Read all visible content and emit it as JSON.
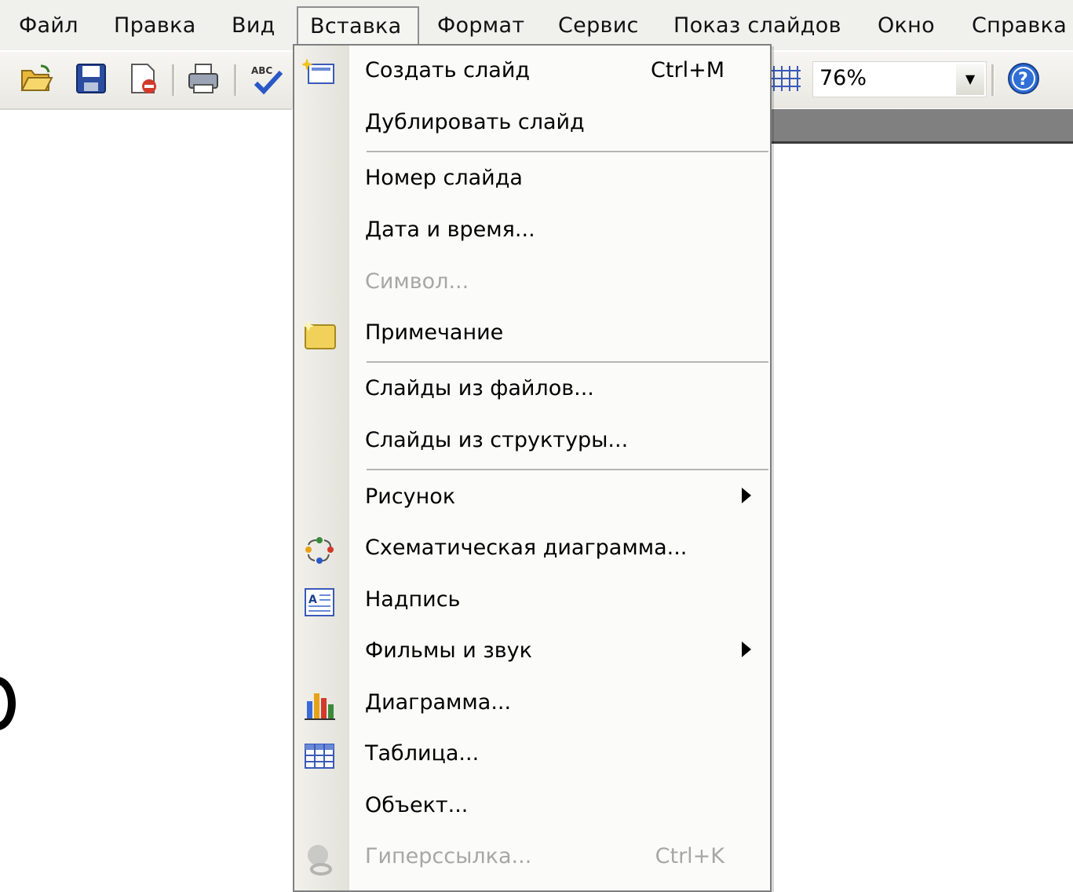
{
  "menubar": {
    "items": [
      {
        "label": "Файл",
        "open": false
      },
      {
        "label": "Правка",
        "open": false
      },
      {
        "label": "Вид",
        "open": false
      },
      {
        "label": "Вставка",
        "open": true
      },
      {
        "label": "Формат",
        "open": false
      },
      {
        "label": "Сервис",
        "open": false
      },
      {
        "label": "Показ слайдов",
        "open": false
      },
      {
        "label": "Окно",
        "open": false
      },
      {
        "label": "Справка",
        "open": false
      }
    ]
  },
  "toolbar": {
    "icons": [
      "open-folder-icon",
      "save-icon",
      "permission-icon",
      "print-icon",
      "spelling-icon",
      "grid-icon",
      "help-icon"
    ],
    "zoom": {
      "value": "76%"
    }
  },
  "dropdown": {
    "items": [
      {
        "label": "Создать слайд",
        "shortcut": "Ctrl+M",
        "icon": "new-slide-icon",
        "enabled": true
      },
      {
        "label": "Дублировать слайд",
        "shortcut": "",
        "icon": "",
        "enabled": true
      },
      {
        "label": "Номер слайда",
        "shortcut": "",
        "icon": "",
        "enabled": true
      },
      {
        "label": "Дата и время...",
        "shortcut": "",
        "icon": "",
        "enabled": true
      },
      {
        "label": "Символ...",
        "shortcut": "",
        "icon": "",
        "enabled": false
      },
      {
        "label": "Примечание",
        "shortcut": "",
        "icon": "comment-icon",
        "enabled": true
      },
      {
        "label": "Слайды из файлов...",
        "shortcut": "",
        "icon": "",
        "enabled": true
      },
      {
        "label": "Слайды из структуры...",
        "shortcut": "",
        "icon": "",
        "enabled": true
      },
      {
        "label": "Рисунок",
        "shortcut": "",
        "icon": "",
        "enabled": true,
        "submenu": true
      },
      {
        "label": "Схематическая диаграмма...",
        "shortcut": "",
        "icon": "diagram-icon",
        "enabled": true
      },
      {
        "label": "Надпись",
        "shortcut": "",
        "icon": "text-box-icon",
        "enabled": true
      },
      {
        "label": "Фильмы и звук",
        "shortcut": "",
        "icon": "",
        "enabled": true,
        "submenu": true
      },
      {
        "label": "Диаграмма...",
        "shortcut": "",
        "icon": "chart-icon",
        "enabled": true
      },
      {
        "label": "Таблица...",
        "shortcut": "",
        "icon": "table-icon",
        "enabled": true
      },
      {
        "label": "Объект...",
        "shortcut": "",
        "icon": "",
        "enabled": true
      },
      {
        "label": "Гиперссылка...",
        "shortcut": "Ctrl+K",
        "icon": "hyperlink-icon",
        "enabled": false
      }
    ]
  }
}
